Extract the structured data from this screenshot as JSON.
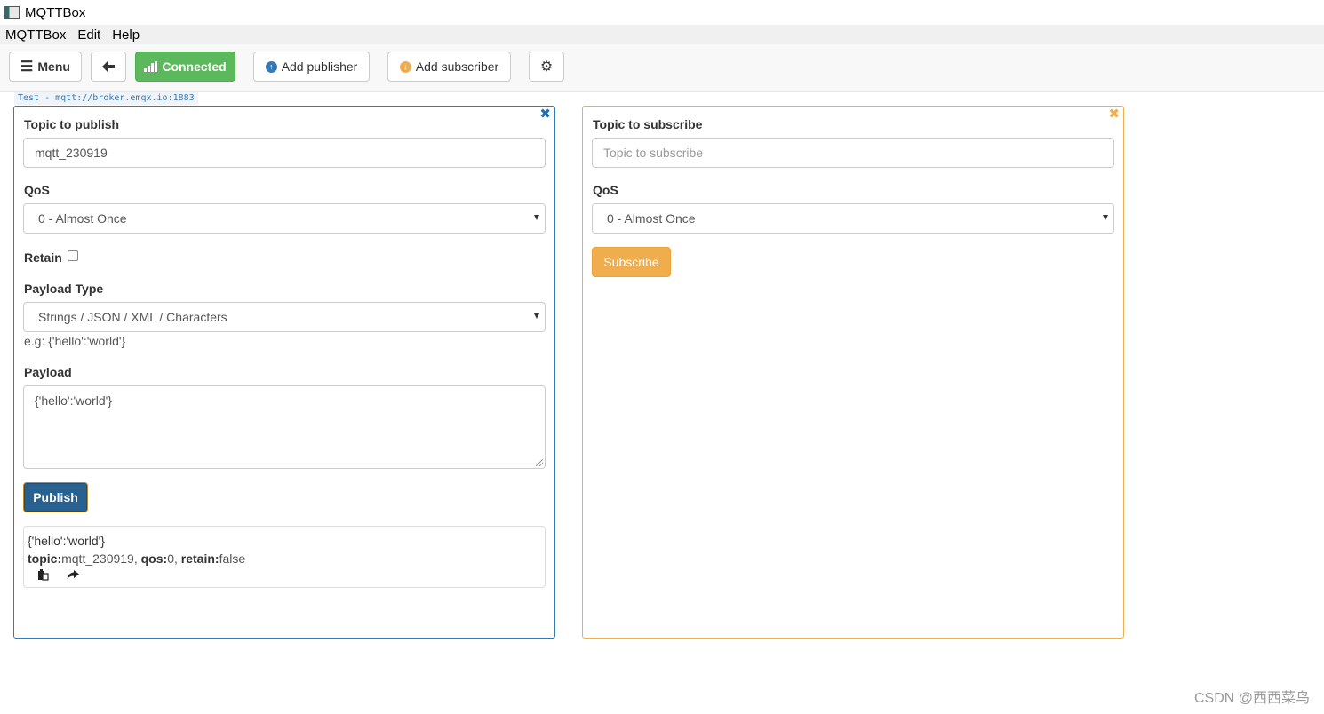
{
  "window": {
    "title": "MQTTBox"
  },
  "menubar": {
    "items": [
      "MQTTBox",
      "Edit",
      "Help"
    ]
  },
  "toolbar": {
    "menu_label": "Menu",
    "status_label": "Connected",
    "add_publisher_label": "Add publisher",
    "add_subscriber_label": "Add subscriber",
    "status_color": "#5cb85c"
  },
  "connection": {
    "tag": "Test - mqtt://broker.emqx.io:1883"
  },
  "publisher": {
    "topic_label": "Topic to publish",
    "topic_value": "mqtt_230919",
    "qos_label": "QoS",
    "qos_value": "0 - Almost Once",
    "retain_label": "Retain",
    "retain_checked": false,
    "payload_type_label": "Payload Type",
    "payload_type_value": "Strings / JSON / XML / Characters",
    "payload_hint": "e.g: {'hello':'world'}",
    "payload_label": "Payload",
    "payload_value": "{'hello':'world'}",
    "publish_label": "Publish",
    "accent_color": "#337ab7",
    "message": {
      "payload": "{'hello':'world'}",
      "topic_key": "topic:",
      "topic_val": "mqtt_230919,",
      "qos_key": "qos:",
      "qos_val": "0,",
      "retain_key": "retain:",
      "retain_val": "false"
    }
  },
  "subscriber": {
    "topic_label": "Topic to subscribe",
    "topic_placeholder": "Topic to subscribe",
    "qos_label": "QoS",
    "qos_value": "0 - Almost Once",
    "subscribe_label": "Subscribe",
    "accent_color": "#f0ad4e"
  },
  "watermark": "CSDN @西西菜鸟"
}
